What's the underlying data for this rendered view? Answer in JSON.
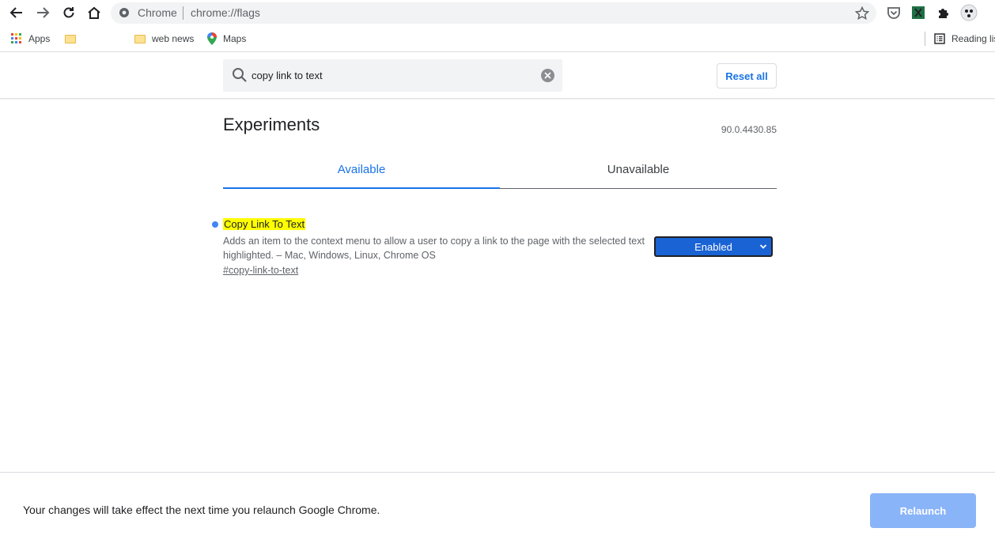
{
  "browser": {
    "omnibox": {
      "site_label": "Chrome",
      "url": "chrome://flags"
    }
  },
  "bookmarks": {
    "items": [
      {
        "label": "Apps",
        "icon": "apps-grid-icon"
      },
      {
        "label": "",
        "icon": "folder-icon"
      },
      {
        "label": "web news",
        "icon": "folder-icon"
      },
      {
        "label": "Maps",
        "icon": "maps-pin-icon"
      }
    ],
    "reading_list": "Reading list"
  },
  "flags": {
    "search": {
      "value": "copy link to text",
      "placeholder": "Search flags"
    },
    "reset_all_label": "Reset all",
    "title": "Experiments",
    "version": "90.0.4430.85",
    "tabs": [
      {
        "label": "Available",
        "active": true
      },
      {
        "label": "Unavailable",
        "active": false
      }
    ],
    "experiment": {
      "name": "Copy Link To Text",
      "description": "Adds an item to the context menu to allow a user to copy a link to the page with the selected text highlighted. – Mac, Windows, Linux, Chrome OS",
      "link": "#copy-link-to-text",
      "state": "Enabled"
    }
  },
  "footer": {
    "message": "Your changes will take effect the next time you relaunch Google Chrome.",
    "relaunch_label": "Relaunch"
  },
  "colors": {
    "accent": "#1a73e8",
    "highlight": "#ffff00",
    "relaunch": "#8ab4f8"
  }
}
